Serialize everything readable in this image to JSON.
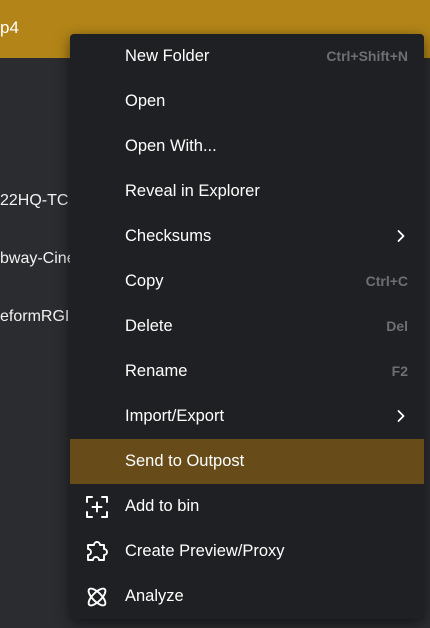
{
  "window": {
    "title_fragment": "p4"
  },
  "file_list": {
    "rows": [
      "22HQ-TC.",
      "bway-Cine",
      "eformRGI"
    ]
  },
  "context_menu": {
    "items": [
      {
        "label": "New Folder",
        "shortcut": "Ctrl+Shift+N"
      },
      {
        "label": "Open",
        "shortcut": ""
      },
      {
        "label": "Open With...",
        "shortcut": ""
      },
      {
        "label": "Reveal in Explorer",
        "shortcut": ""
      },
      {
        "label": "Checksums",
        "shortcut": "",
        "submenu": true
      },
      {
        "label": "Copy",
        "shortcut": "Ctrl+C"
      },
      {
        "label": "Delete",
        "shortcut": "Del"
      },
      {
        "label": "Rename",
        "shortcut": "F2"
      },
      {
        "label": "Import/Export",
        "shortcut": "",
        "submenu": true
      },
      {
        "label": "Send to Outpost",
        "shortcut": "",
        "highlighted": true
      },
      {
        "label": "Add to bin",
        "shortcut": "",
        "icon": "add-to-bin-icon"
      },
      {
        "label": "Create Preview/Proxy",
        "shortcut": "",
        "icon": "puzzle-icon"
      },
      {
        "label": "Analyze",
        "shortcut": "",
        "icon": "atom-icon"
      }
    ]
  },
  "colors": {
    "accent": "#b38518",
    "highlight": "#674c1a",
    "menu_bg": "#1f2023",
    "shortcut_text": "#6e6f73"
  }
}
